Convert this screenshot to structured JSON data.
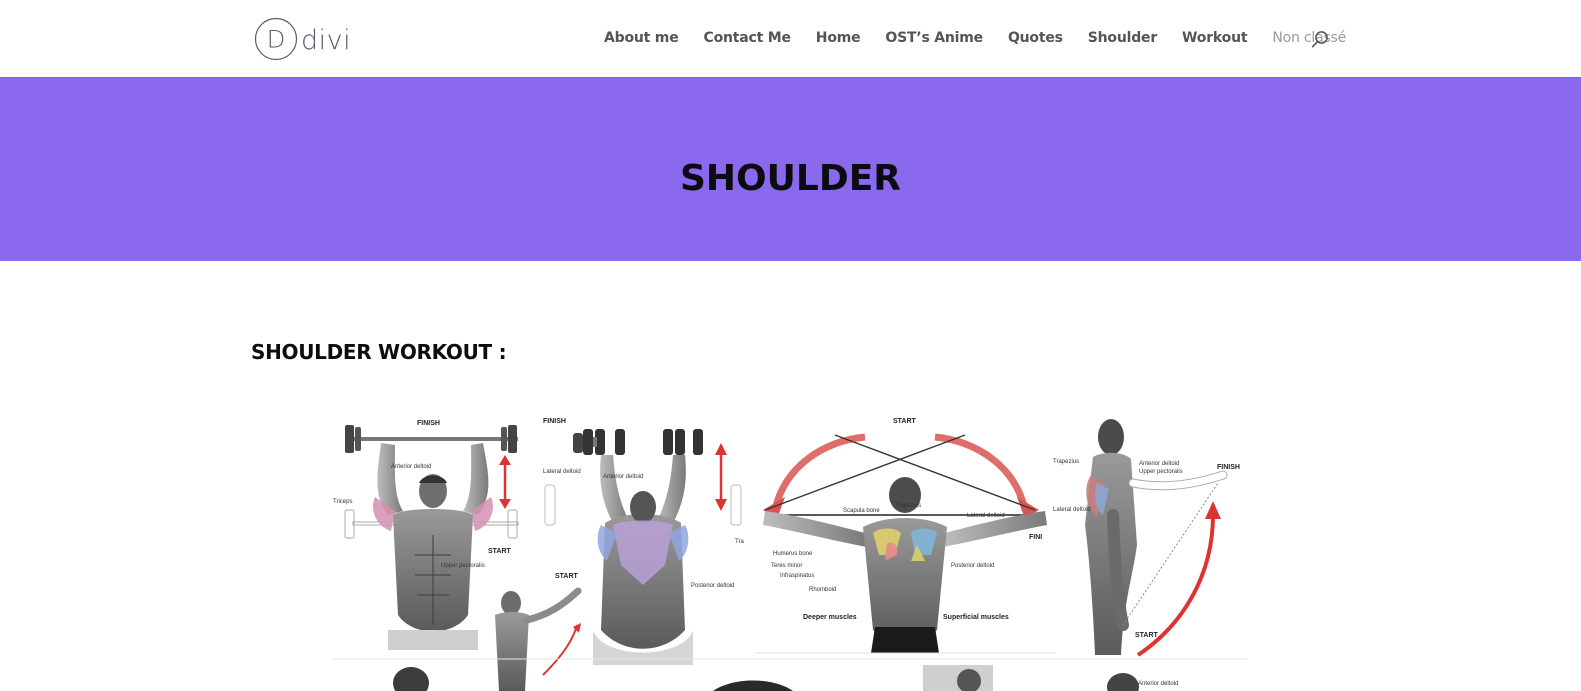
{
  "header": {
    "logo": {
      "letter": "D",
      "text": "divi"
    },
    "nav": [
      {
        "label": "About me"
      },
      {
        "label": "Contact Me"
      },
      {
        "label": "Home"
      },
      {
        "label": "OST’s Anime"
      },
      {
        "label": "Quotes"
      },
      {
        "label": "Shoulder"
      },
      {
        "label": "Workout"
      },
      {
        "label": "Non classé"
      }
    ],
    "search_icon": "search-icon"
  },
  "hero": {
    "title": "SHOULDER",
    "background_color": "#8b69ee"
  },
  "content": {
    "section_heading": "SHOULDER WORKOUT :",
    "figure": {
      "panels": [
        {
          "labels": [
            "FINISH",
            "Anterior deltoid",
            "Triceps",
            "START",
            "Upper pectoralis"
          ]
        },
        {
          "labels": [
            "FINISH",
            "Lateral deltoid",
            "Anterior deltoid",
            "START",
            "Tra",
            "Posterior deltoid"
          ]
        },
        {
          "labels": [
            "START",
            "Scapula bone",
            "Trapezius",
            "Lateral deltoid",
            "FINI",
            "Humerus bone",
            "Teres minor",
            "Infraspinatus",
            "Rhomboid",
            "Posterior deltoid",
            "Deeper muscles",
            "Superficial muscles"
          ]
        },
        {
          "labels": [
            "Trapezius",
            "Anterior deltoid",
            "Upper pectoralis",
            "FINISH",
            "Lateral deltoid",
            "START"
          ]
        },
        {
          "labels": [
            "Anterior deltoid"
          ]
        }
      ]
    }
  }
}
